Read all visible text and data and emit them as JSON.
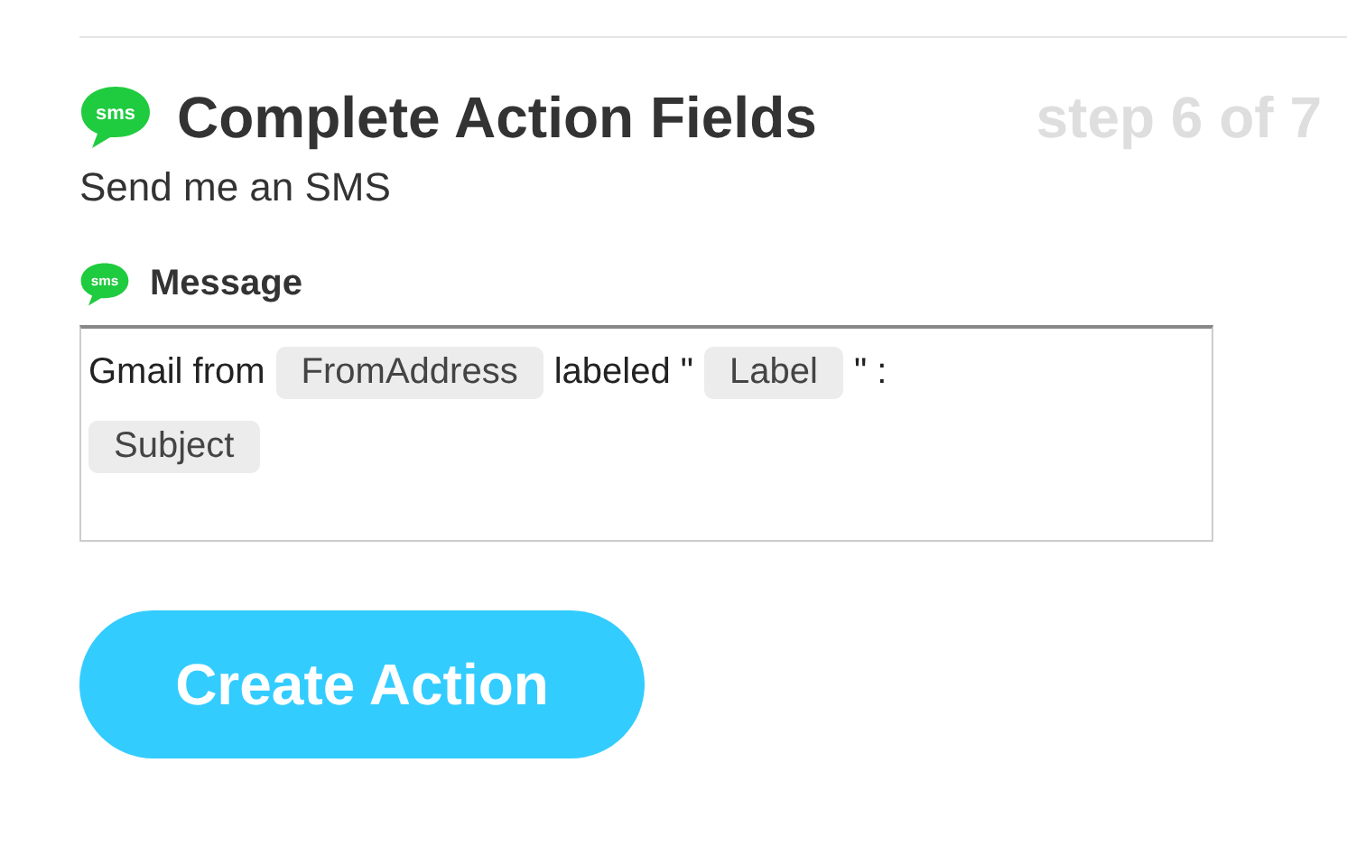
{
  "header": {
    "icon_text": "sms",
    "title": "Complete Action Fields",
    "step": "step 6 of 7"
  },
  "subtitle": "Send me an SMS",
  "field": {
    "icon_text": "sms",
    "label": "Message",
    "content": [
      {
        "kind": "text",
        "text": "Gmail from"
      },
      {
        "kind": "token",
        "text": "FromAddress"
      },
      {
        "kind": "text",
        "text": "labeled \""
      },
      {
        "kind": "token",
        "text": "Label"
      },
      {
        "kind": "text",
        "text": "\" :"
      },
      {
        "kind": "break"
      },
      {
        "kind": "token",
        "text": "Subject"
      }
    ]
  },
  "button": "Create Action"
}
